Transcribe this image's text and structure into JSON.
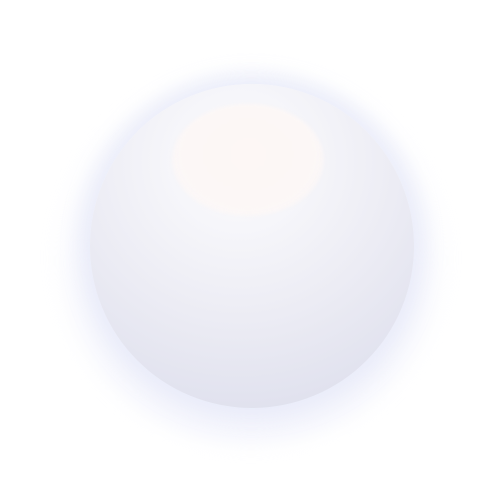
{
  "scene": {
    "subject_icon": "sphere-icon",
    "colors": {
      "background": "#ffffff",
      "sphere_light": "#f6f6fa",
      "sphere_shade": "#d9dbea",
      "highlight": "#fcf7f6",
      "halo": "#e8eaf8"
    }
  }
}
